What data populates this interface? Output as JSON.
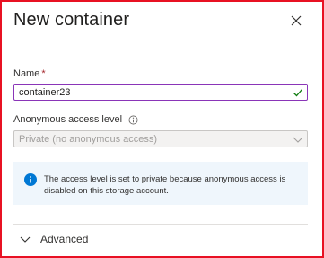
{
  "panel": {
    "title": "New container",
    "close_icon": "close-icon"
  },
  "form": {
    "name_label": "Name",
    "name_required_marker": "*",
    "name_value": "container23",
    "name_valid_icon": "checkmark-icon",
    "access_label": "Anonymous access level",
    "access_info_icon": "info-icon",
    "access_value": "Private (no anonymous access)",
    "access_chevron_icon": "chevron-down-icon"
  },
  "info_message": {
    "icon": "info-filled-icon",
    "text": "The access level is set to private because anonymous access is disabled on this storage account."
  },
  "advanced": {
    "label": "Advanced",
    "icon": "chevron-down-icon"
  },
  "colors": {
    "frame_border": "#e81123",
    "input_focus_border": "#8a35b8",
    "valid_check": "#107c10",
    "info_blue": "#0078d4",
    "info_background": "#eff6fc",
    "required_red": "#a4262c"
  }
}
